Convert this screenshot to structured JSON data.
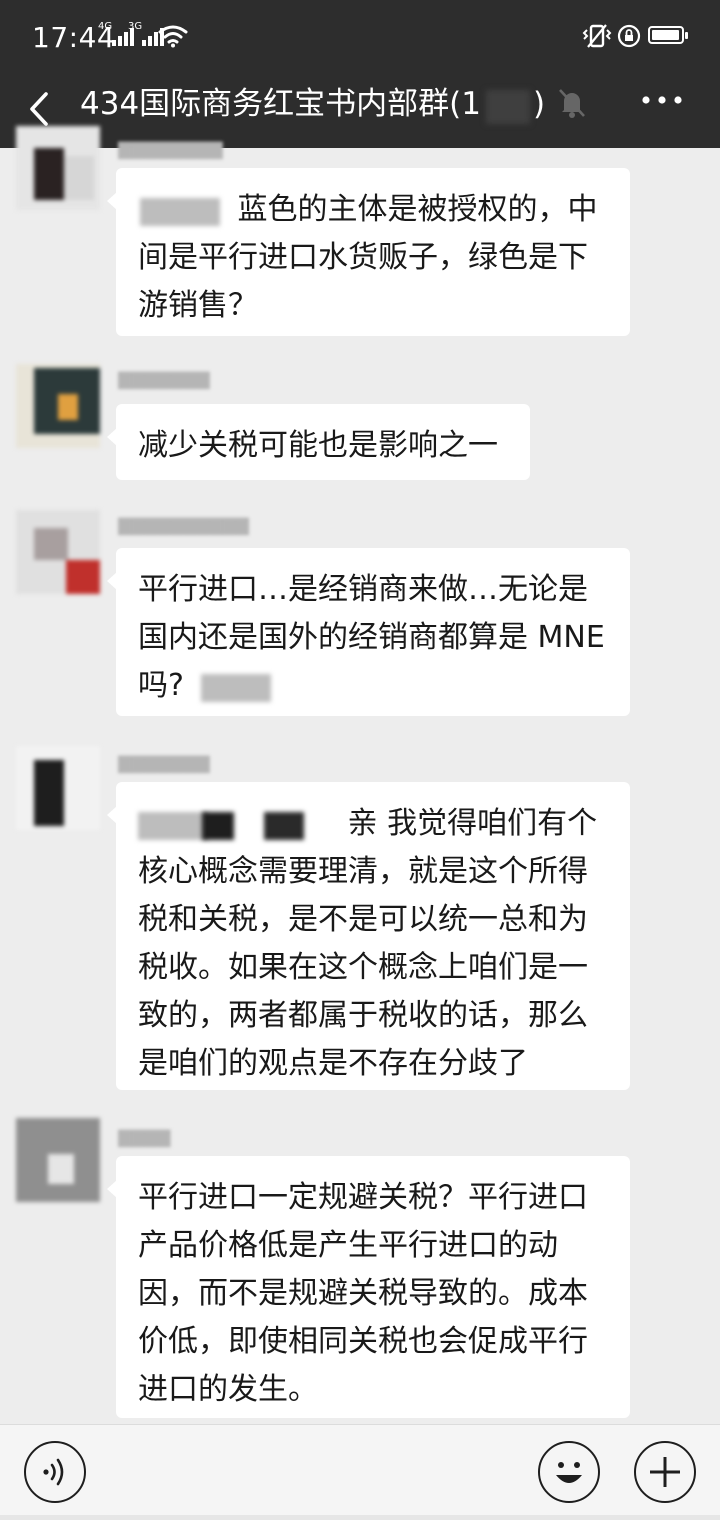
{
  "status_bar": {
    "time": "17:44",
    "signal_1_label": "4G",
    "signal_2_label": "3G"
  },
  "header": {
    "title": "434国际商务红宝书内部群(1",
    "title_close": ")",
    "back_icon": "chevron-left-icon",
    "mute_icon": "bell-off-icon",
    "more_icon": "more-dots-icon",
    "background": "#2d2d2d"
  },
  "messages": [
    {
      "text": "蓝色的主体是被授权的，中间是平行进口水货贩子，绿色是下游销售？"
    },
    {
      "text": "减少关税可能也是影响之一"
    },
    {
      "text": "平行进口…是经销商来做…无论是国内还是国外的经销商都算是 MNE 吗?"
    },
    {
      "text": "亲 我觉得咱们有个核心概念需要理清，就是这个所得税和关税，是不是可以统一总和为税收。如果在这个概念上咱们是一致的，两者都属于税收的话，那么是咱们的观点是不存在分歧了"
    },
    {
      "text": "平行进口一定规避关税？平行进口产品价格低是产生平行进口的动因，而不是规避关税导致的。成本价低，即使相同关税也会促成平行进口的发生。"
    }
  ],
  "input_bar": {
    "voice_icon": "voice-icon",
    "emoji_icon": "emoji-icon",
    "plus_icon": "plus-icon"
  },
  "colors": {
    "chat_background": "#ededed",
    "bubble": "#ffffff",
    "text": "#191919"
  }
}
